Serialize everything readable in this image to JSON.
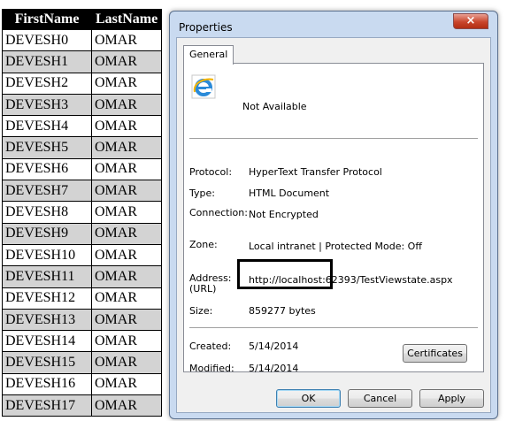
{
  "grid": {
    "headers": [
      "FirstName",
      "LastName"
    ],
    "rows": [
      [
        "DEVESH0",
        "OMAR"
      ],
      [
        "DEVESH1",
        "OMAR"
      ],
      [
        "DEVESH2",
        "OMAR"
      ],
      [
        "DEVESH3",
        "OMAR"
      ],
      [
        "DEVESH4",
        "OMAR"
      ],
      [
        "DEVESH5",
        "OMAR"
      ],
      [
        "DEVESH6",
        "OMAR"
      ],
      [
        "DEVESH7",
        "OMAR"
      ],
      [
        "DEVESH8",
        "OMAR"
      ],
      [
        "DEVESH9",
        "OMAR"
      ],
      [
        "DEVESH10",
        "OMAR"
      ],
      [
        "DEVESH11",
        "OMAR"
      ],
      [
        "DEVESH12",
        "OMAR"
      ],
      [
        "DEVESH13",
        "OMAR"
      ],
      [
        "DEVESH14",
        "OMAR"
      ],
      [
        "DEVESH15",
        "OMAR"
      ],
      [
        "DEVESH16",
        "OMAR"
      ],
      [
        "DEVESH17",
        "OMAR"
      ]
    ]
  },
  "dialog": {
    "title": "Properties",
    "close_label": "×",
    "tab_label": "General",
    "page_title": "Not Available",
    "page_icon": "internet-explorer-icon",
    "fields": {
      "protocol": {
        "label": "Protocol:",
        "value": "HyperText Transfer Protocol"
      },
      "type": {
        "label": "Type:",
        "value": "HTML Document"
      },
      "connection": {
        "label": "Connection:",
        "value": "Not Encrypted"
      },
      "zone": {
        "label": "Zone:",
        "value": "Local intranet | Protected Mode: Off"
      },
      "address": {
        "label_line1": "Address:",
        "label_line2": "(URL)",
        "value": "http://localhost:62393/TestViewstate.aspx"
      },
      "size": {
        "label": "Size:",
        "value": "859277 bytes"
      },
      "created": {
        "label": "Created:",
        "value": "5/14/2014"
      },
      "modified": {
        "label": "Modified:",
        "value": "5/14/2014"
      }
    },
    "buttons": {
      "certificates": "Certificates",
      "ok": "OK",
      "cancel": "Cancel",
      "apply": "Apply"
    }
  },
  "colors": {
    "grid_header_bg": "#000000",
    "grid_alt_row_bg": "#d3d3d3",
    "dialog_frame": "#c9daf0",
    "close_button": "#c9452c"
  }
}
